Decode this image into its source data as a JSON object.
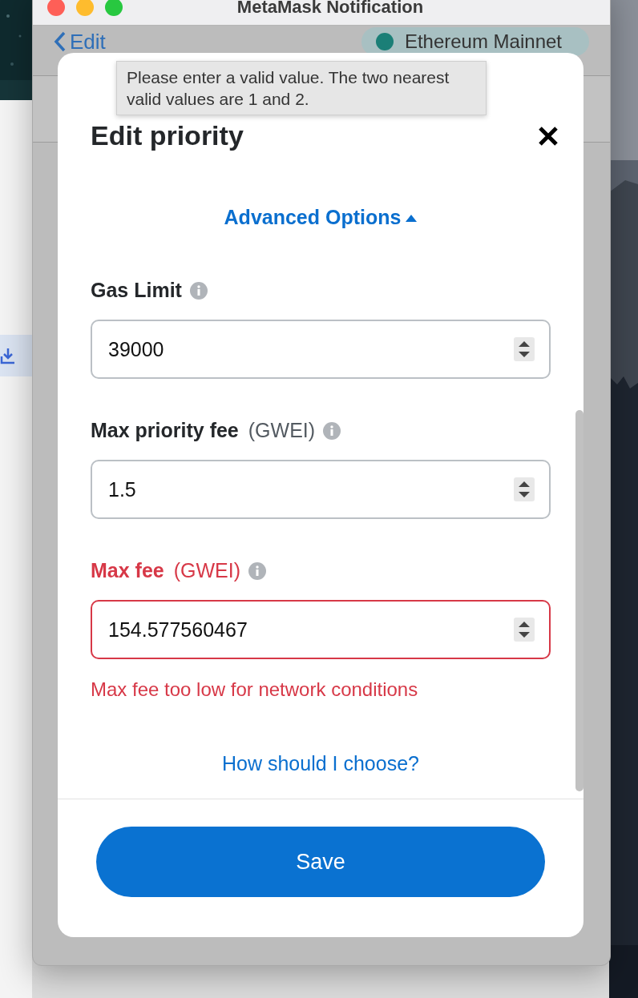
{
  "window": {
    "title": "MetaMask Notification"
  },
  "header": {
    "back_link": "Edit",
    "network": "Ethereum Mainnet"
  },
  "modal": {
    "title": "Edit priority",
    "tooltip": "Please enter a valid value. The two nearest valid values are 1 and 2.",
    "advanced_options": {
      "label": "Advanced Options",
      "expanded": true
    },
    "fields": [
      {
        "label": "Gas Limit",
        "value": "39000",
        "invalid": false
      },
      {
        "label": "Max priority fee",
        "unit": "(GWEI)",
        "value": "1.5",
        "invalid": false
      },
      {
        "label": "Max fee",
        "unit": "(GWEI)",
        "value": "154.577560467",
        "invalid": true
      }
    ],
    "error_message": "Max fee too low for network conditions",
    "help_link": "How should I choose?",
    "save_button": "Save"
  }
}
